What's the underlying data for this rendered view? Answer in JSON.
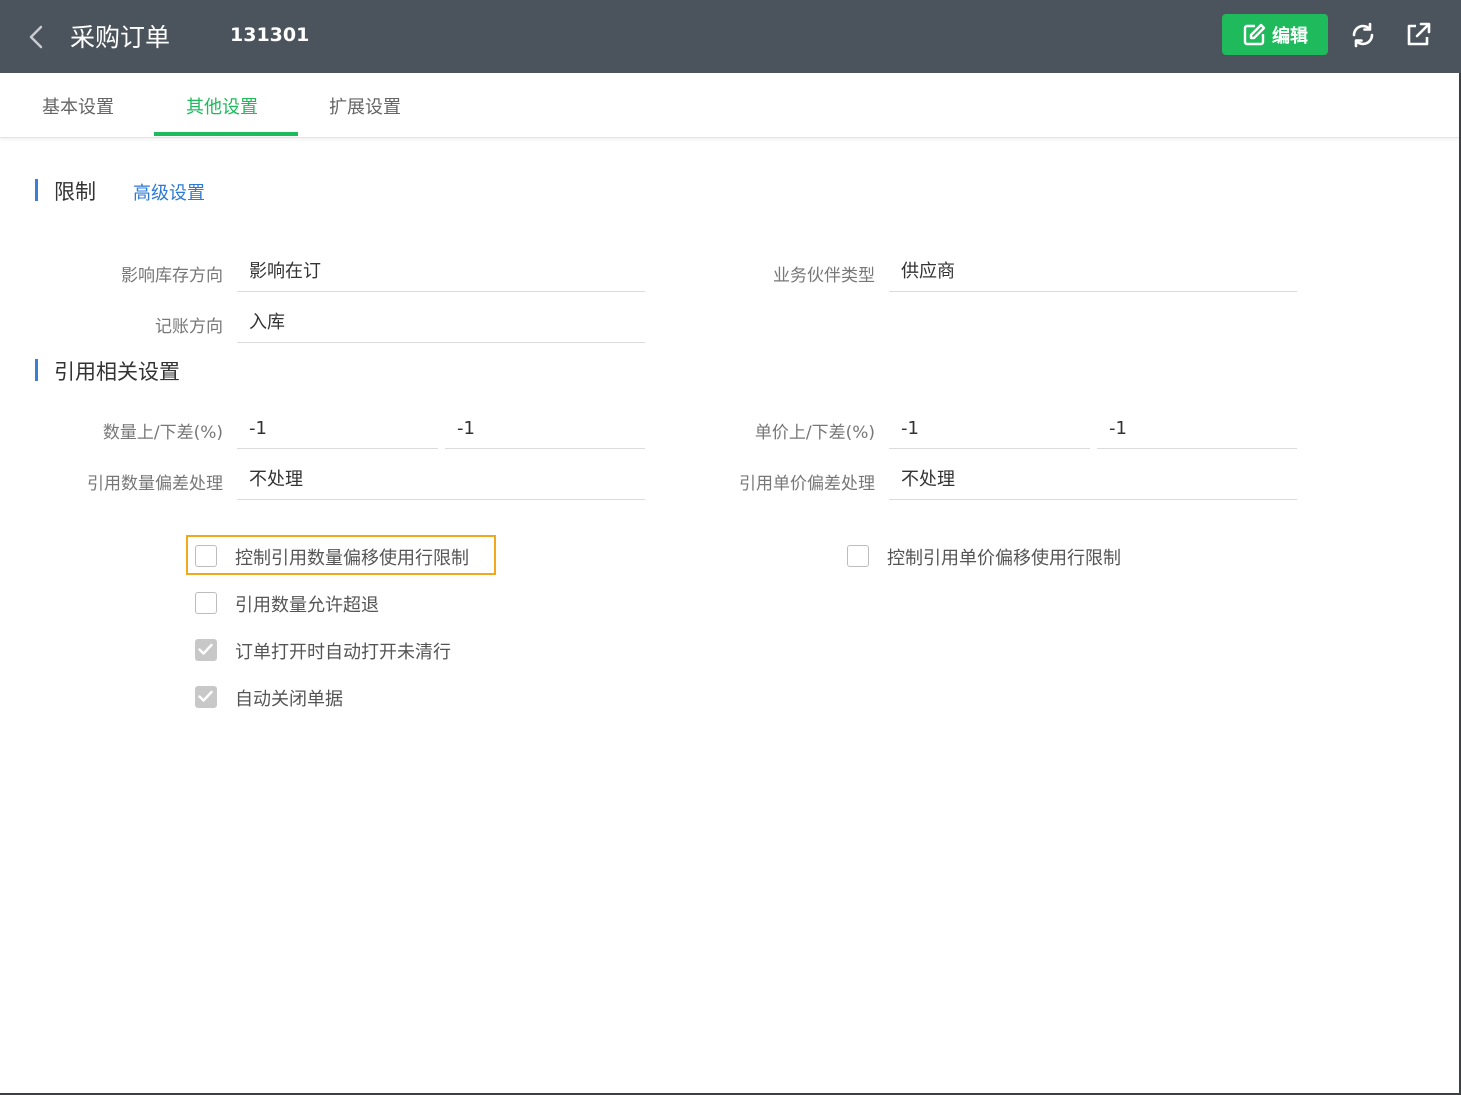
{
  "header": {
    "title": "采购订单",
    "doc_number": "131301",
    "edit_label": "编辑",
    "accent_color": "#1fba5c",
    "background_color": "#4b535c"
  },
  "tabs": [
    {
      "label": "基本设置",
      "active": false
    },
    {
      "label": "其他设置",
      "active": true
    },
    {
      "label": "扩展设置",
      "active": false
    }
  ],
  "section_limit": {
    "title": "限制",
    "advanced_link": "高级设置",
    "fields": {
      "stock_direction": {
        "label": "影响库存方向",
        "value": "影响在订"
      },
      "partner_type": {
        "label": "业务伙伴类型",
        "value": "供应商"
      },
      "posting_direction": {
        "label": "记账方向",
        "value": "入库"
      }
    }
  },
  "section_ref": {
    "title": "引用相关设置",
    "fields": {
      "qty_tolerance": {
        "label": "数量上/下差(%)",
        "upper": "-1",
        "lower": "-1"
      },
      "price_tolerance": {
        "label": "单价上/下差(%)",
        "upper": "-1",
        "lower": "-1"
      },
      "qty_deviation": {
        "label": "引用数量偏差处理",
        "value": "不处理"
      },
      "price_deviation": {
        "label": "引用单价偏差处理",
        "value": "不处理"
      }
    },
    "checkboxes": {
      "ctrl_qty_offset": {
        "label": "控制引用数量偏移使用行限制",
        "checked": false,
        "highlighted": true
      },
      "ctrl_price_offset": {
        "label": "控制引用单价偏移使用行限制",
        "checked": false
      },
      "allow_qty_over": {
        "label": "引用数量允许超退",
        "checked": false
      },
      "auto_open_uncleared": {
        "label": "订单打开时自动打开未清行",
        "checked": true
      },
      "auto_close": {
        "label": "自动关闭单据",
        "checked": true
      }
    }
  },
  "highlight_color": "#f2a81d",
  "section_bar_color": "#3a7fd5"
}
